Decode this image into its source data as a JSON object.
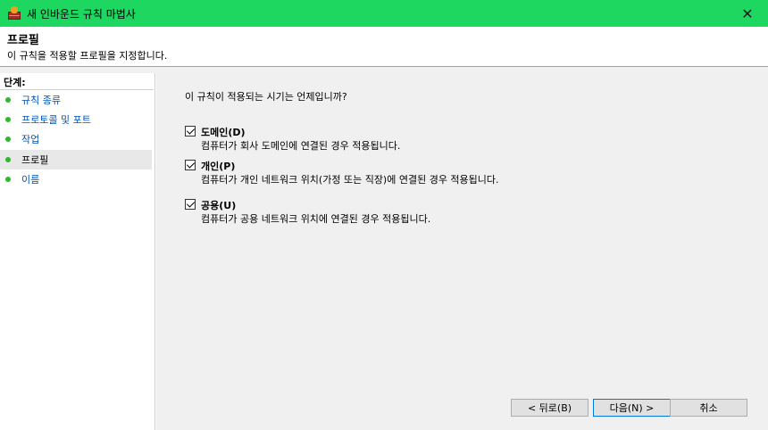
{
  "window": {
    "title": "새 인바운드 규칙 마법사",
    "close_glyph": "✕"
  },
  "header": {
    "title": "프로필",
    "description": "이 규칙을 적용할 프로필을 지정합니다."
  },
  "sidebar": {
    "steps_label": "단계:",
    "items": [
      {
        "label": "규칙 종류"
      },
      {
        "label": "프로토콜 및 포트"
      },
      {
        "label": "작업"
      },
      {
        "label": "프로필"
      },
      {
        "label": "이름"
      }
    ],
    "active_index": 3
  },
  "main": {
    "question": "이 규칙이 적용되는 시기는 언제입니까?",
    "options": [
      {
        "label": "도메인(D)",
        "description": "컴퓨터가 회사 도메인에 연결된 경우 적용됩니다.",
        "checked": true
      },
      {
        "label": "개인(P)",
        "description": "컴퓨터가 개인 네트워크 위치(가정 또는 직장)에 연결된 경우 적용됩니다.",
        "checked": true
      },
      {
        "label": "공용(U)",
        "description": "컴퓨터가 공용 네트워크 위치에 연결된 경우 적용됩니다.",
        "checked": true
      }
    ]
  },
  "buttons": {
    "back": "< 뒤로(B)",
    "next": "다음(N) >",
    "cancel": "취소"
  },
  "colors": {
    "titlebar": "#1ed760",
    "link": "#0055b8",
    "dot": "#2eb82e"
  },
  "icons": {
    "app": "firewall-icon",
    "step_bullet": "green-dot-icon"
  }
}
